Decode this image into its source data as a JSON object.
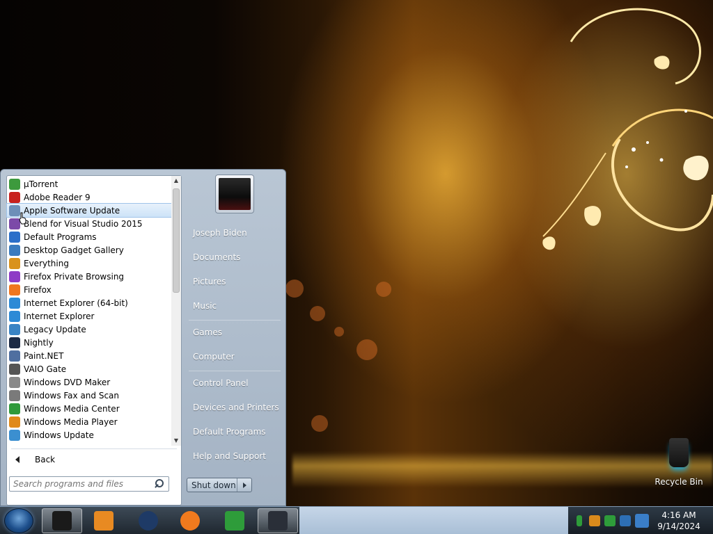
{
  "desktop": {
    "recycle_bin_label": "Recycle Bin"
  },
  "start_menu": {
    "programs": [
      {
        "label": "µTorrent",
        "icon": "utorrent-icon",
        "color": "#3d9a3d"
      },
      {
        "label": "Adobe Reader 9",
        "icon": "adobe-reader-icon",
        "color": "#c8211e"
      },
      {
        "label": "Apple Software Update",
        "icon": "apple-software-update-icon",
        "color": "#6d8fb8"
      },
      {
        "label": "Blend for Visual Studio 2015",
        "icon": "blend-icon",
        "color": "#7c4aa8"
      },
      {
        "label": "Default Programs",
        "icon": "default-programs-icon",
        "color": "#2b6fc9"
      },
      {
        "label": "Desktop Gadget Gallery",
        "icon": "gadget-gallery-icon",
        "color": "#3a7bbf"
      },
      {
        "label": "Everything",
        "icon": "everything-search-icon",
        "color": "#d9921c"
      },
      {
        "label": "Firefox Private Browsing",
        "icon": "firefox-private-icon",
        "color": "#8e3bc6"
      },
      {
        "label": "Firefox",
        "icon": "firefox-icon",
        "color": "#f0761e"
      },
      {
        "label": "Internet Explorer (64-bit)",
        "icon": "internet-explorer-icon",
        "color": "#2d8ad6"
      },
      {
        "label": "Internet Explorer",
        "icon": "internet-explorer-icon",
        "color": "#2d8ad6"
      },
      {
        "label": "Legacy Update",
        "icon": "legacy-update-icon",
        "color": "#3a84c4"
      },
      {
        "label": "Nightly",
        "icon": "nightly-icon",
        "color": "#1b2a44"
      },
      {
        "label": "Paint.NET",
        "icon": "paint-net-icon",
        "color": "#4f6fa0"
      },
      {
        "label": "VAIO Gate",
        "icon": "vaio-gate-icon",
        "color": "#555555"
      },
      {
        "label": "Windows DVD Maker",
        "icon": "dvd-maker-icon",
        "color": "#8a8a8a"
      },
      {
        "label": "Windows Fax and Scan",
        "icon": "fax-scan-icon",
        "color": "#7a7a7a"
      },
      {
        "label": "Windows Media Center",
        "icon": "media-center-icon",
        "color": "#2f9a3a"
      },
      {
        "label": "Windows Media Player",
        "icon": "media-player-icon",
        "color": "#e08a1a"
      },
      {
        "label": "Windows Update",
        "icon": "windows-update-icon",
        "color": "#3b8fd0"
      }
    ],
    "highlighted_index": 2,
    "back_label": "Back",
    "search_placeholder": "Search programs and files",
    "right_links": [
      "Joseph Biden",
      "Documents",
      "Pictures",
      "Music",
      "Games",
      "Computer",
      "Control Panel",
      "Devices and Printers",
      "Default Programs",
      "Help and Support"
    ],
    "shutdown_label": "Shut down"
  },
  "taskbar": {
    "pinned": [
      {
        "name": "task-app-1",
        "icon": "monitor-app-icon",
        "color": "#1a1a1a"
      },
      {
        "name": "task-app-2",
        "icon": "media-player-taskbar-icon",
        "color": "#e88a22"
      },
      {
        "name": "task-app-3",
        "icon": "nightly-taskbar-icon",
        "color": "#1e3a66"
      },
      {
        "name": "task-app-4",
        "icon": "firefox-taskbar-icon",
        "color": "#f07a1e"
      },
      {
        "name": "task-app-5",
        "icon": "internet-download-manager-icon",
        "color": "#2e9c3a"
      },
      {
        "name": "task-app-6",
        "icon": "display-app-icon",
        "color": "#2a2f38"
      }
    ],
    "clock_time": "4:16 AM",
    "clock_date": "9/14/2024"
  },
  "colors": {
    "menu_bg": "#a4b3c4",
    "highlight": "#cde3f8",
    "taskbar": "#a9bfd6"
  }
}
